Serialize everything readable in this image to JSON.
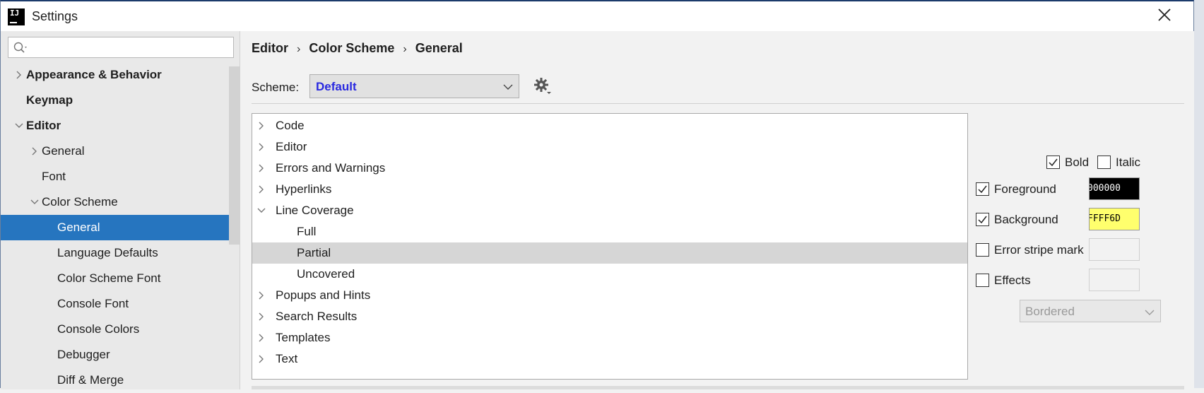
{
  "window": {
    "title": "Settings"
  },
  "sidebar": {
    "search_placeholder": "",
    "items": [
      {
        "label": "Appearance & Behavior",
        "level": 0,
        "bold": true,
        "expandable": true,
        "expanded": false
      },
      {
        "label": "Keymap",
        "level": 0,
        "bold": true,
        "expandable": false
      },
      {
        "label": "Editor",
        "level": 0,
        "bold": true,
        "expandable": true,
        "expanded": true
      },
      {
        "label": "General",
        "level": 1,
        "expandable": true,
        "expanded": false
      },
      {
        "label": "Font",
        "level": 1,
        "expandable": false
      },
      {
        "label": "Color Scheme",
        "level": 1,
        "expandable": true,
        "expanded": true
      },
      {
        "label": "General",
        "level": 2,
        "selected": true
      },
      {
        "label": "Language Defaults",
        "level": 2
      },
      {
        "label": "Color Scheme Font",
        "level": 2
      },
      {
        "label": "Console Font",
        "level": 2
      },
      {
        "label": "Console Colors",
        "level": 2
      },
      {
        "label": "Debugger",
        "level": 2
      },
      {
        "label": "Diff & Merge",
        "level": 2
      }
    ]
  },
  "breadcrumb": [
    "Editor",
    "Color Scheme",
    "General"
  ],
  "scheme": {
    "label": "Scheme:",
    "value": "Default"
  },
  "tree": [
    {
      "label": "Code",
      "level": 0,
      "expandable": true
    },
    {
      "label": "Editor",
      "level": 0,
      "expandable": true
    },
    {
      "label": "Errors and Warnings",
      "level": 0,
      "expandable": true
    },
    {
      "label": "Hyperlinks",
      "level": 0,
      "expandable": true
    },
    {
      "label": "Line Coverage",
      "level": 0,
      "expandable": true,
      "expanded": true
    },
    {
      "label": "Full",
      "level": 1
    },
    {
      "label": "Partial",
      "level": 1,
      "selected": true
    },
    {
      "label": "Uncovered",
      "level": 1
    },
    {
      "label": "Popups and Hints",
      "level": 0,
      "expandable": true
    },
    {
      "label": "Search Results",
      "level": 0,
      "expandable": true
    },
    {
      "label": "Templates",
      "level": 0,
      "expandable": true
    },
    {
      "label": "Text",
      "level": 0,
      "expandable": true
    }
  ],
  "props": {
    "bold": {
      "label": "Bold",
      "checked": true
    },
    "italic": {
      "label": "Italic",
      "checked": false
    },
    "foreground": {
      "label": "Foreground",
      "checked": true,
      "value": "000000",
      "color": "#000000",
      "text_color": "#ffffff"
    },
    "background": {
      "label": "Background",
      "checked": true,
      "value": "FFFF6D",
      "color": "#ffff6d",
      "text_color": "#000000"
    },
    "error_stripe": {
      "label": "Error stripe mark",
      "checked": false
    },
    "effects": {
      "label": "Effects",
      "checked": false,
      "type_value": "Bordered"
    }
  },
  "colors": {
    "selection": "#2675bf",
    "scheme_value": "#2929e0",
    "tree_highlight": "#d6d6d6"
  }
}
